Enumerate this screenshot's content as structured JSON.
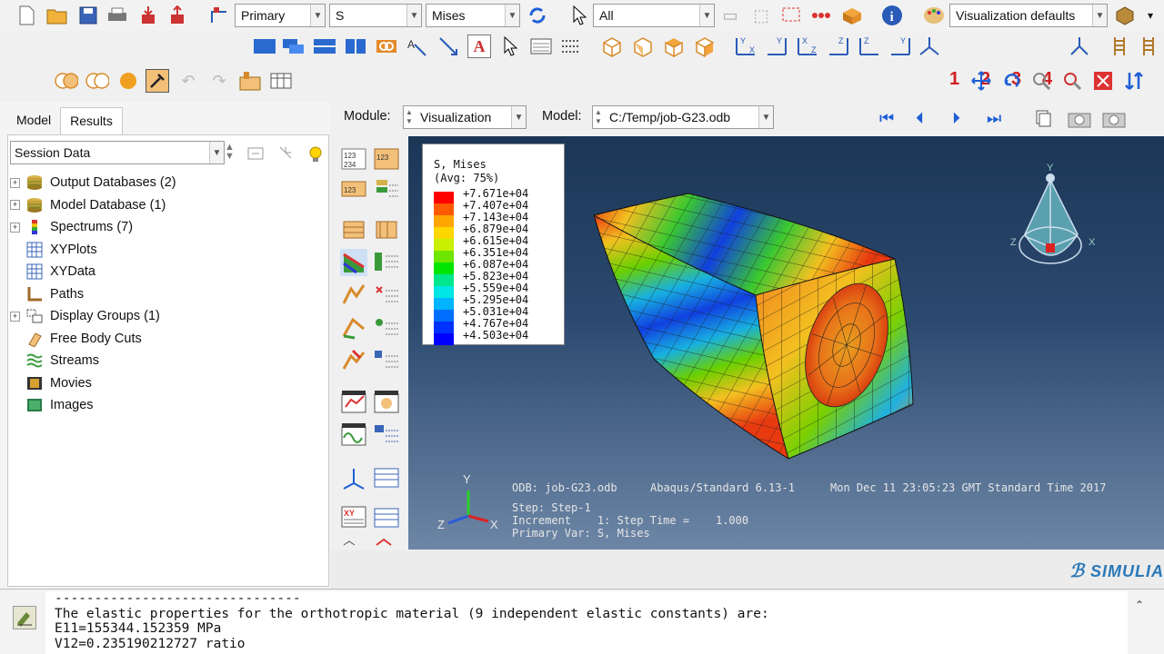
{
  "toolbar": {
    "primary_combo": "Primary",
    "field_combo": "S",
    "invariant_combo": "Mises",
    "select_combo": "All",
    "viz_defaults_combo": "Visualization defaults",
    "view_numbers": [
      "1",
      "2",
      "3",
      "4"
    ]
  },
  "tabs": [
    "Model",
    "Results"
  ],
  "session": {
    "combo": "Session Data"
  },
  "tree": [
    {
      "label": "Output Databases (2)",
      "expandable": true,
      "icon": "database-icon"
    },
    {
      "label": "Model Database (1)",
      "expandable": true,
      "icon": "database-icon"
    },
    {
      "label": "Spectrums (7)",
      "expandable": true,
      "icon": "spectrum-icon"
    },
    {
      "label": "XYPlots",
      "expandable": false,
      "icon": "grid-icon"
    },
    {
      "label": "XYData",
      "expandable": false,
      "icon": "grid-icon"
    },
    {
      "label": "Paths",
      "expandable": false,
      "icon": "path-icon"
    },
    {
      "label": "Display Groups (1)",
      "expandable": true,
      "icon": "display-group-icon"
    },
    {
      "label": "Free Body Cuts",
      "expandable": false,
      "icon": "free-body-icon"
    },
    {
      "label": "Streams",
      "expandable": false,
      "icon": "streams-icon"
    },
    {
      "label": "Movies",
      "expandable": false,
      "icon": "movie-icon"
    },
    {
      "label": "Images",
      "expandable": false,
      "icon": "image-icon"
    }
  ],
  "module_bar": {
    "module_label": "Module:",
    "module_value": "Visualization",
    "model_label": "Model:",
    "model_value": "C:/Temp/job-G23.odb"
  },
  "legend": {
    "title_line1": "S, Mises",
    "title_line2": "(Avg: 75%)",
    "values": [
      "+7.671e+04",
      "+7.407e+04",
      "+7.143e+04",
      "+6.879e+04",
      "+6.615e+04",
      "+6.351e+04",
      "+6.087e+04",
      "+5.823e+04",
      "+5.559e+04",
      "+5.295e+04",
      "+5.031e+04",
      "+4.767e+04",
      "+4.503e+04"
    ],
    "colors": [
      "#ff0000",
      "#ff5a00",
      "#ffa500",
      "#ffd700",
      "#c8f000",
      "#6ee600",
      "#00e600",
      "#00e68c",
      "#00e6e6",
      "#00b4ff",
      "#006eff",
      "#0032ff",
      "#0000ff"
    ]
  },
  "viewport": {
    "odb": "ODB: job-G23.odb",
    "solver": "Abaqus/Standard 6.13-1",
    "datetime": "Mon Dec 11 23:05:23 GMT Standard Time 2017",
    "step_line": "Step: Step-1",
    "increment_line": "Increment    1: Step Time =    1.000",
    "primary_var_line": "Primary Var: S, Mises",
    "triad_y": "Y",
    "triad_z": "Z",
    "triad_x": "X",
    "view_y": "Y",
    "view_z": "Z",
    "view_x": "X"
  },
  "brand": "SIMULIA",
  "console": {
    "lines": [
      "-------------------------------",
      "The elastic properties for the orthotropic material (9 independent elastic constants) are:",
      "E11=155344.152359 MPa",
      "V12=0.235190212727 ratio"
    ]
  },
  "colors": {
    "accent": "#1e5fd6",
    "view_number": "#d11e1e",
    "viewport_top": "#1b3656",
    "viewport_bottom": "#6d86a6"
  }
}
